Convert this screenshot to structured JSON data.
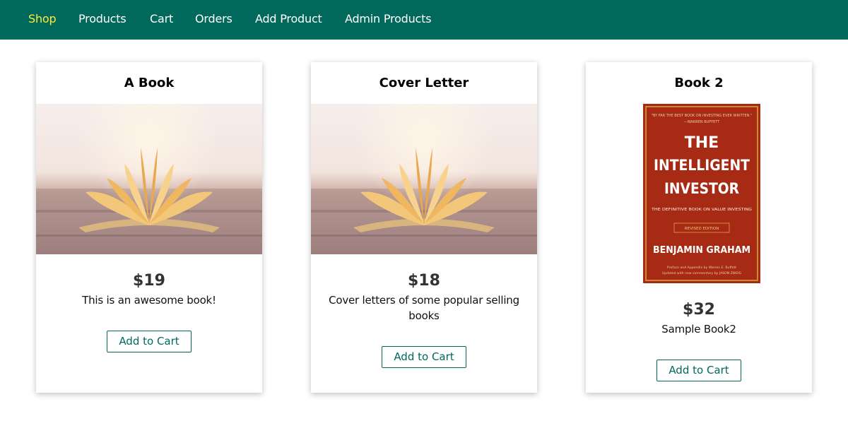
{
  "nav": {
    "items": [
      {
        "label": "Shop",
        "active": true
      },
      {
        "label": "Products",
        "active": false
      },
      {
        "label": "Cart",
        "active": false
      },
      {
        "label": "Orders",
        "active": false
      },
      {
        "label": "Add Product",
        "active": false
      },
      {
        "label": "Admin Products",
        "active": false
      }
    ]
  },
  "colors": {
    "header_bg": "#00695c",
    "nav_active": "#ffeb3b",
    "nav_text": "#ffffff",
    "button_accent": "#00695c",
    "cover_red": "#a62a14"
  },
  "products": [
    {
      "title": "A Book",
      "image": "open-book-photo",
      "price": "$19",
      "description": "This is an awesome book!",
      "button_label": "Add to Cart"
    },
    {
      "title": "Cover Letter",
      "image": "open-book-photo",
      "price": "$18",
      "description": "Cover letters of some popular selling books",
      "button_label": "Add to Cart"
    },
    {
      "title": "Book 2",
      "image": "book-cover-intelligent-investor",
      "price": "$32",
      "description": "Sample Book2",
      "button_label": "Add to Cart",
      "cover": {
        "quote": "\"BY FAR THE BEST BOOK ON INVESTING EVER WRITTEN.\"",
        "quote_author": "—WARREN BUFFETT",
        "title_line_1": "THE",
        "title_line_2": "INTELLIGENT",
        "title_line_3": "INVESTOR",
        "subtitle": "THE DEFINITIVE BOOK ON VALUE INVESTING",
        "edition": "REVISED EDITION",
        "author": "BENJAMIN GRAHAM",
        "footer_1": "Preface and Appendix by Warren E. Buffett",
        "footer_2": "Updated with new commentary by JASON ZWEIG"
      }
    }
  ]
}
